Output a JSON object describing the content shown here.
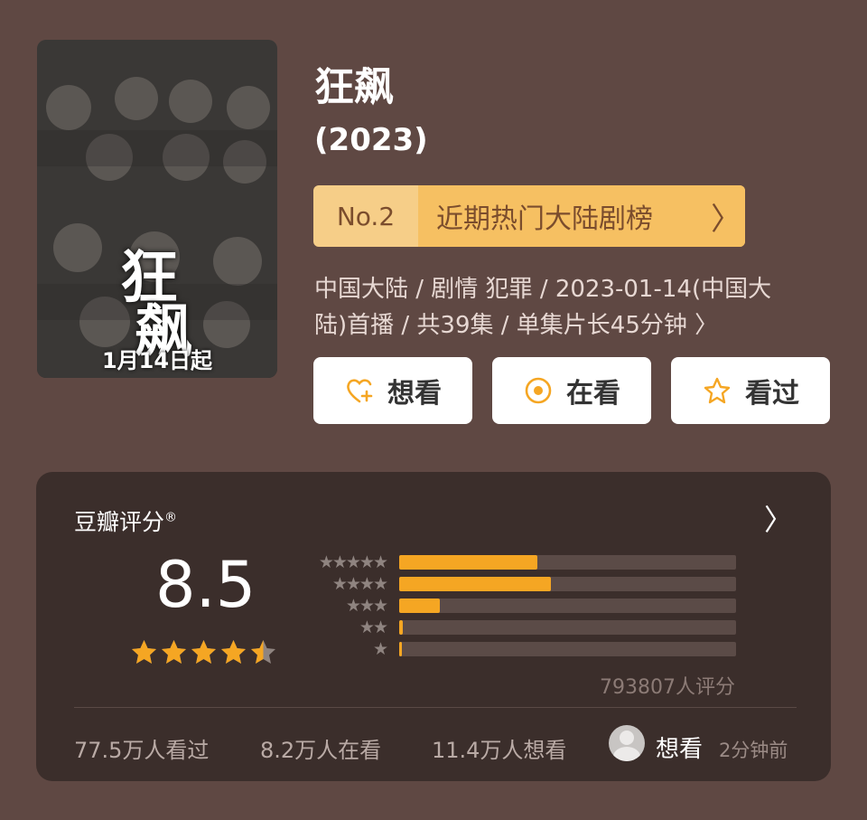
{
  "poster": {
    "date_text": "1月14日起",
    "title_chars": [
      "狂",
      "飙"
    ]
  },
  "title": "狂飙",
  "year": "(2023)",
  "rank": {
    "no": "No.2",
    "list": "近期热门大陆剧榜",
    "chevron": "〉"
  },
  "meta": {
    "line1": "中国大陆 / 剧情 犯罪 / 2023-01-14(中国大",
    "line2": "陆)首播 / 共39集 / 单集片长45分钟 〉"
  },
  "buttons": {
    "want": {
      "label": "想看",
      "icon": "heart-plus-icon"
    },
    "watching": {
      "label": "在看",
      "icon": "circle-dot-icon"
    },
    "watched": {
      "label": "看过",
      "icon": "star-outline-icon"
    }
  },
  "rating": {
    "title": "豆瓣评分",
    "reg": "®",
    "chevron": "〉",
    "score": "8.5",
    "stars": 4.5,
    "distribution": [
      {
        "stars": "★★★★★",
        "fraction": 0.41
      },
      {
        "stars": "★★★★",
        "fraction": 0.45
      },
      {
        "stars": "★★★",
        "fraction": 0.12
      },
      {
        "stars": "★★",
        "fraction": 0.01
      },
      {
        "stars": "★",
        "fraction": 0.005
      }
    ],
    "count": "793807人评分"
  },
  "footer": {
    "watched": "77.5万人看过",
    "watching": "8.2万人在看",
    "want": "11.4万人想看",
    "activity_action": "想看",
    "activity_time": "2分钟前"
  },
  "colors": {
    "accent": "#f5a623",
    "background": "#5f4843",
    "card": "#3b2e2b"
  }
}
